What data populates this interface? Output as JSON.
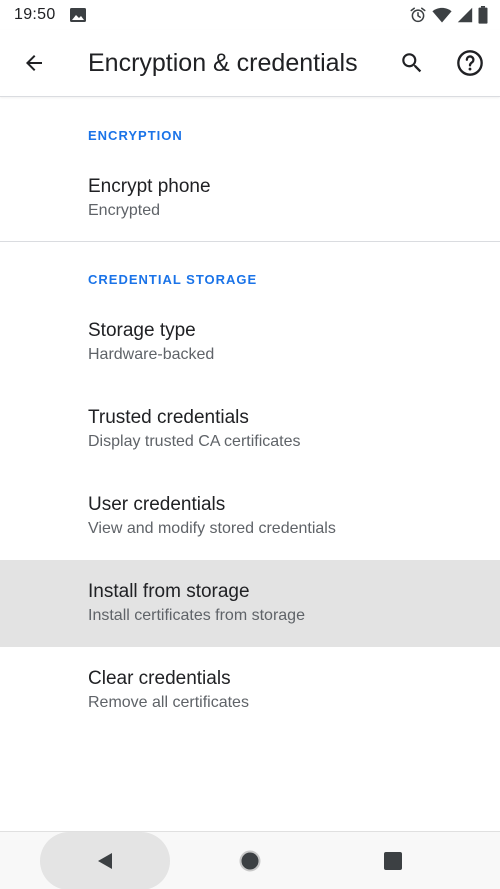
{
  "status_bar": {
    "time": "19:50"
  },
  "toolbar": {
    "title": "Encryption & credentials"
  },
  "sections": [
    {
      "category": "ENCRYPTION",
      "items": [
        {
          "title": "Encrypt phone",
          "summary": "Encrypted"
        }
      ]
    },
    {
      "category": "CREDENTIAL STORAGE",
      "items": [
        {
          "title": "Storage type",
          "summary": "Hardware-backed"
        },
        {
          "title": "Trusted credentials",
          "summary": "Display trusted CA certificates"
        },
        {
          "title": "User credentials",
          "summary": "View and modify stored credentials"
        },
        {
          "title": "Install from storage",
          "summary": "Install certificates from storage"
        },
        {
          "title": "Clear credentials",
          "summary": "Remove all certificates"
        }
      ]
    }
  ],
  "colors": {
    "accent": "#1a73e8",
    "pressed_row": "#e3e3e3",
    "text_primary": "#202124",
    "text_secondary": "#5f6368"
  },
  "icons": {
    "back": "arrow-back-icon",
    "search": "search-icon",
    "help": "help-circle-icon",
    "alarm": "alarm-icon",
    "wifi": "wifi-icon",
    "signal": "signal-icon",
    "battery": "battery-icon",
    "image_notification": "image-icon"
  }
}
